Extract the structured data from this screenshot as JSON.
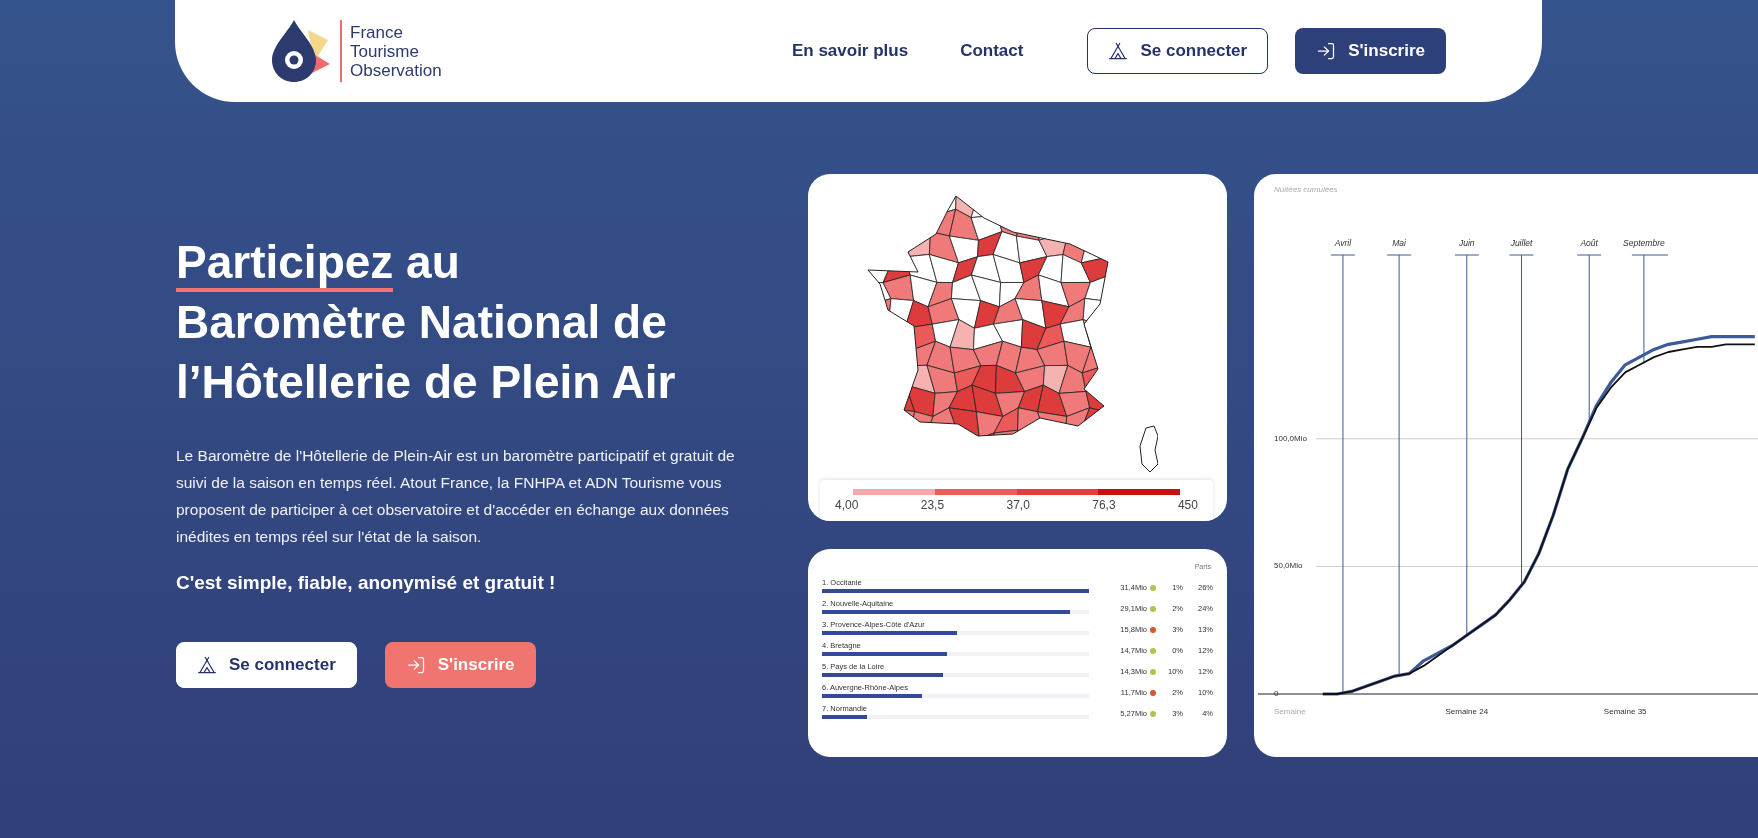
{
  "header": {
    "brand": "France Tourisme Observation",
    "nav": [
      "En savoir plus",
      "Contact"
    ],
    "login_button": "Se connecter",
    "signup_button": "S'inscrire"
  },
  "hero": {
    "title_highlight": "Participez",
    "title_rest": "au Baromètre National de l’Hôtellerie de Plein Air",
    "description": "Le Baromètre de l'Hôtellerie de Plein-Air est un baromètre participatif et gratuit de suivi de la saison en temps réel. Atout France, la FNHPA et ADN Tourisme vous proposent de participer à cet observatoire et d'accéder en échange aux données inédites en temps réel sur l'état de la saison.",
    "tagline": "C'est simple, fiable, anonymisé et gratuit !",
    "login_button": "Se connecter",
    "signup_button": "S'inscrire"
  },
  "map_card": {
    "kind": "picture",
    "legend": {
      "segments": [
        {
          "color": "#f4a9a9"
        },
        {
          "color": "#ee5b5b"
        },
        {
          "color": "#e63c3c"
        },
        {
          "color": "#c90f0f"
        }
      ],
      "labels": [
        "4,00",
        "23,5",
        "37,0",
        "76,3",
        "450"
      ]
    }
  },
  "ranking_card": {
    "share_header": "Parts",
    "rows": [
      {
        "label": "1. Occitanie",
        "level": 1.0,
        "value": "31,4Mio",
        "color": "#a9c94b",
        "change": "1%",
        "share": "26%"
      },
      {
        "label": "2. Nouvelle-Aquitaine",
        "level": 0.93,
        "value": "29,1Mio",
        "color": "#a9c94b",
        "change": "2%",
        "share": "24%"
      },
      {
        "label": "3. Provence-Alpes-Côte d'Azur",
        "level": 0.505,
        "value": "15,8Mio",
        "color": "#d4552f",
        "change": "3%",
        "share": "13%"
      },
      {
        "label": "4. Bretagne",
        "level": 0.47,
        "value": "14,7Mio",
        "color": "#a9c94b",
        "change": "0%",
        "share": "12%"
      },
      {
        "label": "5. Pays de la Loire",
        "level": 0.455,
        "value": "14,3Mio",
        "color": "#a9c94b",
        "change": "10%",
        "share": "12%"
      },
      {
        "label": "6. Auvergne-Rhône-Alpes",
        "level": 0.375,
        "value": "11,7Mio",
        "color": "#d4552f",
        "change": "2%",
        "share": "10%"
      },
      {
        "label": "7. Normandie",
        "level": 0.17,
        "value": "5,27Mio",
        "color": "#a9c94b",
        "change": "3%",
        "share": "4%"
      }
    ]
  },
  "chart_card": {
    "chart_data": {
      "type": "line",
      "title": "Nuitées cumulées",
      "xlabel": "Semaine",
      "categories": [
        null,
        null,
        null,
        null,
        null,
        null,
        null,
        null,
        null,
        null,
        "Semaine 24",
        null,
        null,
        null,
        null,
        null,
        null,
        null,
        null,
        null,
        null,
        "Semaine 35",
        null,
        null,
        null,
        null,
        null,
        null,
        null,
        null,
        null
      ],
      "series": [
        {
          "color": "#3d5a99",
          "values": [
            0,
            0,
            1,
            3,
            5,
            7,
            8,
            13,
            16,
            19,
            23,
            27,
            31,
            37,
            44,
            55,
            70,
            88,
            100,
            113,
            122,
            129,
            132,
            135,
            137,
            138,
            139,
            140,
            140,
            140,
            140
          ]
        },
        {
          "color": "#111111",
          "values": [
            0,
            0,
            1,
            3,
            5,
            7,
            8,
            11,
            15,
            19,
            23,
            27,
            31,
            37,
            44,
            55,
            70,
            88,
            100,
            112,
            120,
            126,
            129,
            132,
            134,
            135,
            136,
            136,
            137,
            137,
            137
          ]
        }
      ],
      "ylim": [
        0,
        172
      ],
      "grid": true,
      "yticks": [
        {
          "value": 0,
          "label": "0"
        },
        {
          "value": 50,
          "label": "50,0Mio"
        },
        {
          "value": 100,
          "label": "100,0Mio"
        }
      ],
      "annotations": [
        "Avril",
        "Mai",
        "Juin",
        "Juillet",
        "Août",
        "Septembre"
      ]
    }
  }
}
